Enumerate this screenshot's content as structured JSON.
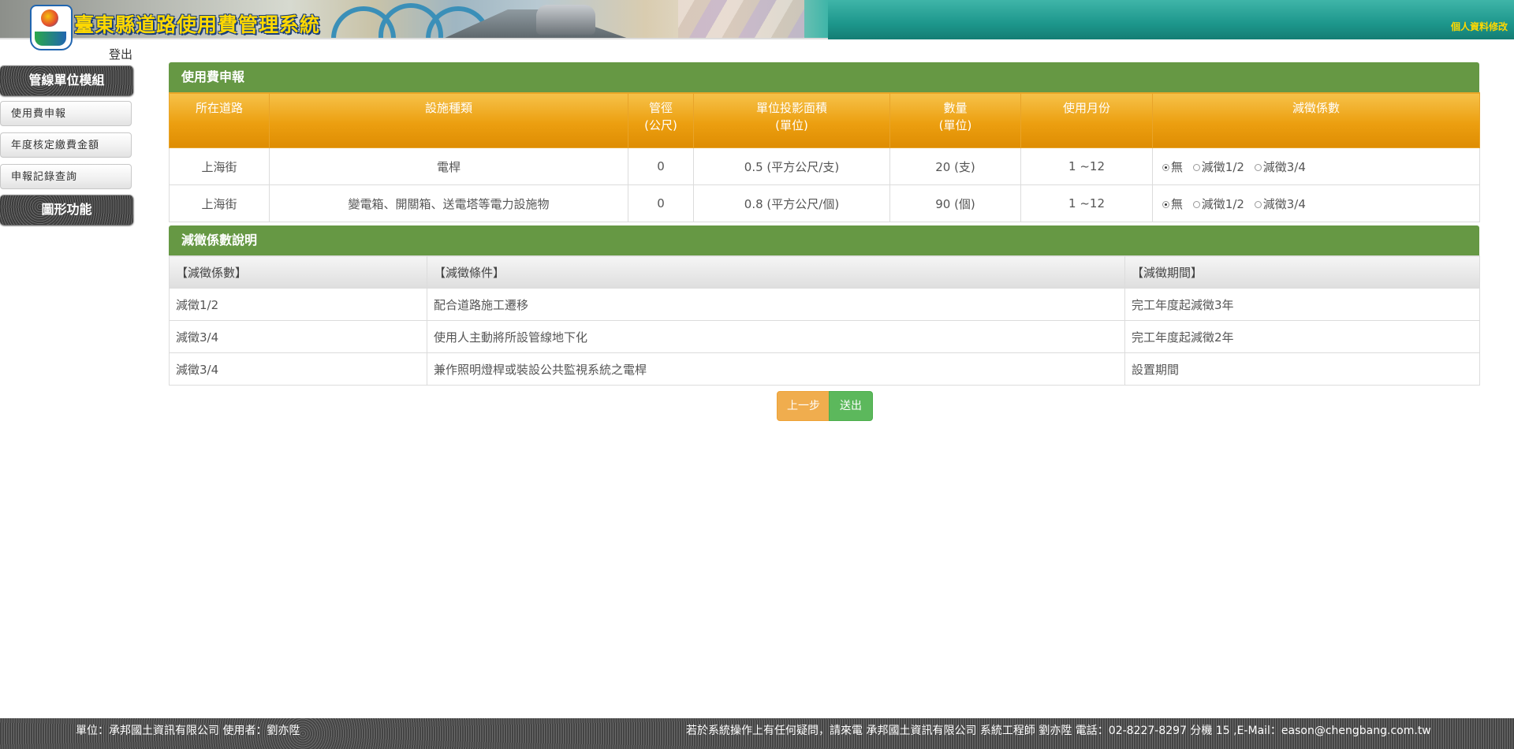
{
  "header": {
    "system_title": "臺東縣道路使用費管理系統",
    "profile_link": "個人資料修改",
    "logout": "登出"
  },
  "sidebar": {
    "module_title": "管線單位模組",
    "items": [
      {
        "label": "使用費申報"
      },
      {
        "label": "年度核定繳費金額"
      },
      {
        "label": "申報記錄查詢"
      }
    ],
    "graphics_title": "圖形功能"
  },
  "fee_panel": {
    "title": "使用費申報",
    "columns": [
      {
        "line1": "所在道路",
        "line2": ""
      },
      {
        "line1": "設施種類",
        "line2": ""
      },
      {
        "line1": "管徑",
        "line2": "(公尺)"
      },
      {
        "line1": "單位投影面積",
        "line2": "(單位)"
      },
      {
        "line1": "數量",
        "line2": "(單位)"
      },
      {
        "line1": "使用月份",
        "line2": ""
      },
      {
        "line1": "減徵係數",
        "line2": ""
      }
    ],
    "rows": [
      {
        "road": "上海街",
        "facility": "電桿",
        "diameter": "0",
        "area": "0.5 (平方公尺/支)",
        "quantity": "20 (支)",
        "months": "1 ~12",
        "options": [
          "無",
          "減徵1/2",
          "減徵3/4"
        ],
        "selected": "無"
      },
      {
        "road": "上海街",
        "facility": "變電箱、開關箱、送電塔等電力設施物",
        "diameter": "0",
        "area": "0.8 (平方公尺/個)",
        "quantity": "90 (個)",
        "months": "1 ~12",
        "options": [
          "無",
          "減徵1/2",
          "減徵3/4"
        ],
        "selected": "無"
      }
    ]
  },
  "desc_panel": {
    "title": "減徵係數說明",
    "columns": [
      "【減徵係數】",
      "【減徵條件】",
      "【減徵期間】"
    ],
    "rows": [
      [
        "減徵1/2",
        "配合道路施工遷移",
        "完工年度起減徵3年"
      ],
      [
        "減徵3/4",
        "使用人主動將所設管線地下化",
        "完工年度起減徵2年"
      ],
      [
        "減徵3/4",
        "兼作照明燈桿或裝設公共監視系統之電桿",
        "設置期間"
      ]
    ]
  },
  "buttons": {
    "prev": "上一步",
    "submit": "送出"
  },
  "footer": {
    "left": "單位：承邦國土資訊有限公司 使用者：劉亦陞",
    "right": "若於系統操作上有任何疑問，請來電 承邦國土資訊有限公司 系統工程師 劉亦陞 電話：02-8227-8297 分機 15 ,E-Mail：eason@chengbang.com.tw"
  },
  "colors": {
    "header_teal": "#1d978c",
    "title_yellow": "#ffd800",
    "panel_green": "#669844",
    "table_orange": "#ec9f10",
    "btn_prev": "#f0ad4e",
    "btn_submit": "#5cb85c"
  }
}
